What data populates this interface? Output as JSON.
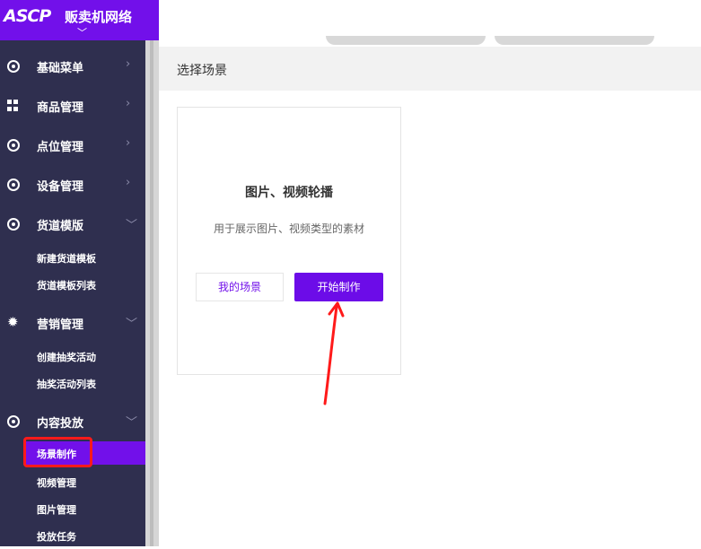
{
  "brand": {
    "logo": "ASCP",
    "name": "贩卖机网络"
  },
  "sidebar": {
    "items": [
      {
        "label": "基础菜单",
        "icon": "ring-icon",
        "expanded": false
      },
      {
        "label": "商品管理",
        "icon": "grid-icon",
        "expanded": false
      },
      {
        "label": "点位管理",
        "icon": "ring-icon",
        "expanded": false
      },
      {
        "label": "设备管理",
        "icon": "ring-icon",
        "expanded": false
      },
      {
        "label": "货道模版",
        "icon": "ring-icon",
        "expanded": true,
        "children": [
          "新建货道模板",
          "货道模板列表"
        ]
      },
      {
        "label": "营销管理",
        "icon": "gear-icon",
        "expanded": true,
        "children": [
          "创建抽奖活动",
          "抽奖活动列表"
        ]
      },
      {
        "label": "内容投放",
        "icon": "ring-icon",
        "expanded": true,
        "children": [
          "场景制作",
          "视频管理",
          "图片管理",
          "投放任务"
        ]
      }
    ],
    "active_item": "场景制作"
  },
  "main": {
    "title": "选择场景",
    "card": {
      "title": "图片、视频轮播",
      "description": "用于展示图片、视频类型的素材",
      "secondary_button": "我的场景",
      "primary_button": "开始制作"
    }
  },
  "colors": {
    "brand": "#7210ea",
    "sidebar_bg": "#2f2f4f",
    "annotation": "#ff1a1a"
  }
}
